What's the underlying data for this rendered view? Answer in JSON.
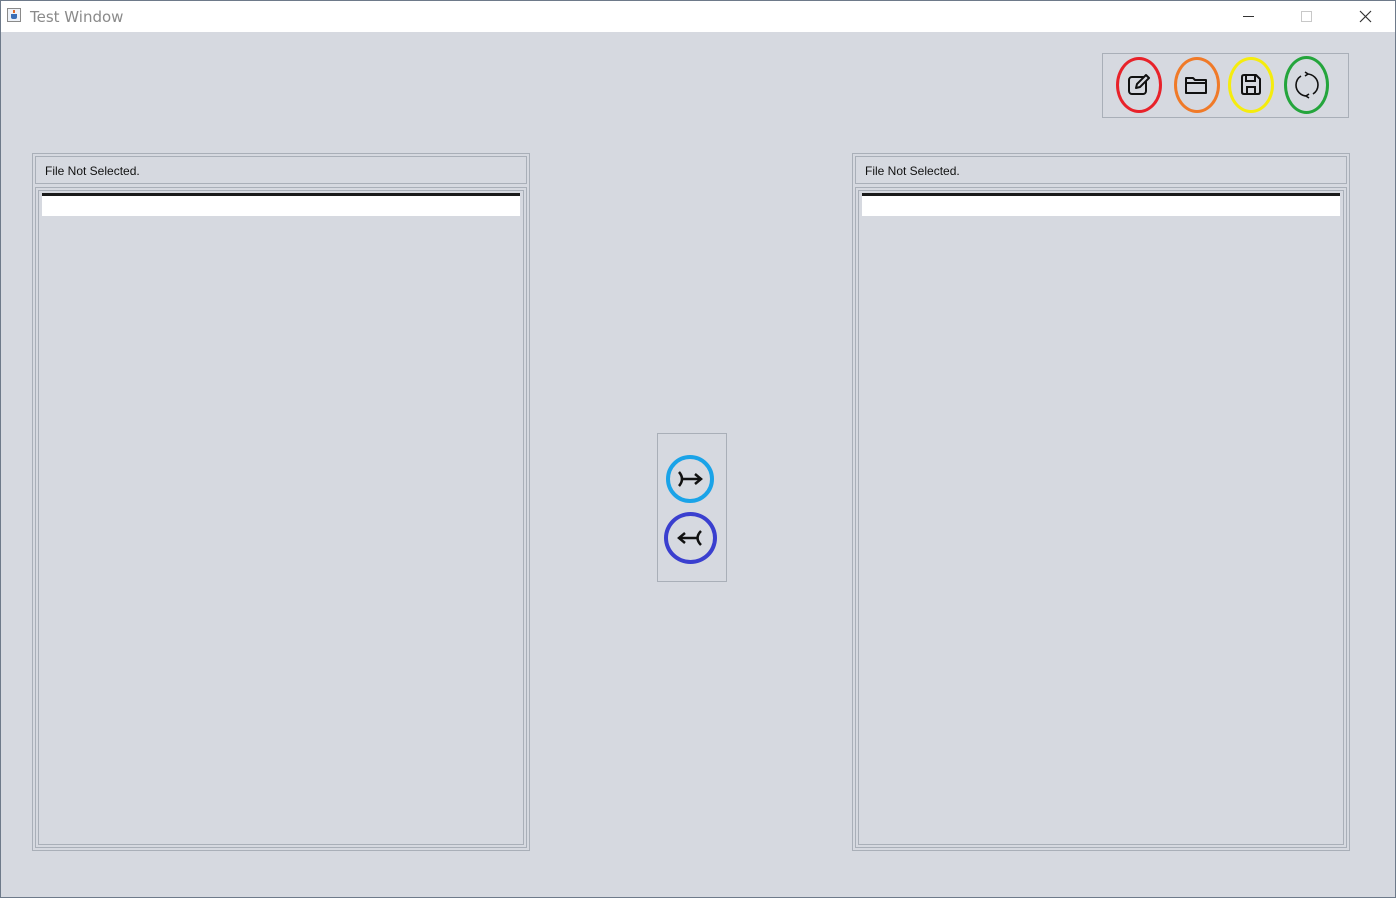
{
  "window": {
    "title": "Test Window",
    "controls": {
      "minimize_icon": "minimize-icon",
      "maximize_icon": "maximize-icon",
      "close_icon": "close-icon"
    }
  },
  "toolbar": {
    "buttons": [
      {
        "icon": "edit-icon",
        "ring_color": "#e8222a"
      },
      {
        "icon": "folder-open-icon",
        "ring_color": "#f07a28"
      },
      {
        "icon": "save-icon",
        "ring_color": "#f5ec0e"
      },
      {
        "icon": "refresh-icon",
        "ring_color": "#24a53c"
      }
    ]
  },
  "left_panel": {
    "status": "File Not Selected."
  },
  "right_panel": {
    "status": "File Not Selected."
  },
  "transfer": {
    "buttons": [
      {
        "icon": "merge-right-icon",
        "ring_color": "#1aa3e8"
      },
      {
        "icon": "merge-left-icon",
        "ring_color": "#3a3fcf"
      }
    ]
  },
  "colors": {
    "background": "#d6d9e0",
    "titlebar": "#ffffff",
    "border": "#a9afb8"
  }
}
